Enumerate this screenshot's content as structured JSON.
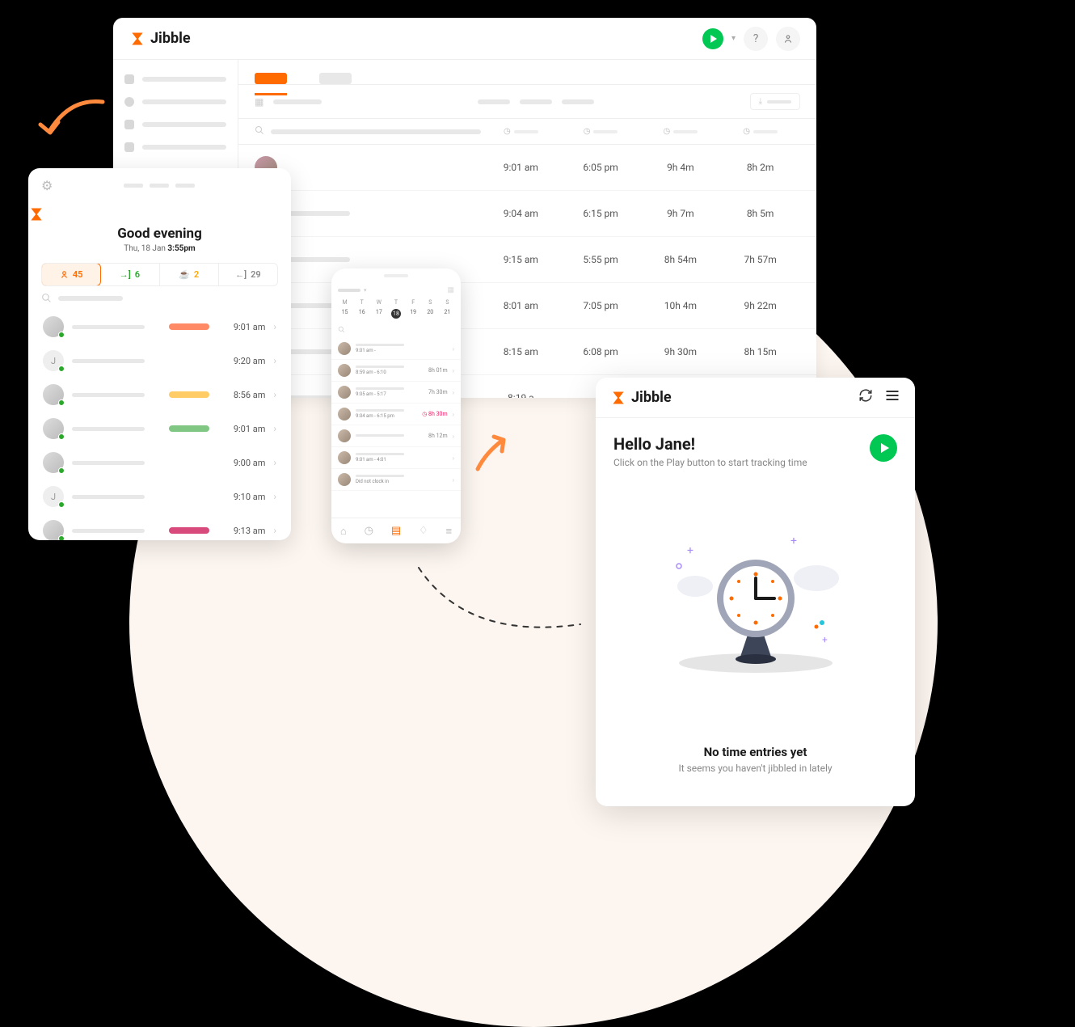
{
  "brand": "Jibble",
  "desktop": {
    "rows": [
      {
        "in": "9:01 am",
        "out": "6:05 pm",
        "tracked": "9h 4m",
        "worked": "8h 2m"
      },
      {
        "in": "9:04 am",
        "out": "6:15 pm",
        "tracked": "9h 7m",
        "worked": "8h 5m"
      },
      {
        "in": "9:15 am",
        "out": "5:55 pm",
        "tracked": "8h 54m",
        "worked": "7h 57m"
      },
      {
        "in": "8:01 am",
        "out": "7:05 pm",
        "tracked": "10h 4m",
        "worked": "9h 22m"
      },
      {
        "in": "8:15 am",
        "out": "6:08 pm",
        "tracked": "9h 30m",
        "worked": "8h 15m"
      },
      {
        "in": "8:19 a",
        "out": "",
        "tracked": "",
        "worked": ""
      }
    ]
  },
  "tablet": {
    "greeting": "Good evening",
    "date_prefix": "Thu, 18 Jan ",
    "date_time": "3:55pm",
    "tabs": {
      "in": "45",
      "enter": "6",
      "break": "2",
      "out": "29"
    },
    "employees": [
      {
        "time": "9:01 am",
        "pill": "#ff8a65",
        "initial": null
      },
      {
        "time": "9:20 am",
        "pill": null,
        "initial": "J"
      },
      {
        "time": "8:56 am",
        "pill": "#ffcc66",
        "initial": null
      },
      {
        "time": "9:01 am",
        "pill": "#81c784",
        "initial": null
      },
      {
        "time": "9:00 am",
        "pill": null,
        "initial": null
      },
      {
        "time": "9:10 am",
        "pill": null,
        "initial": "J"
      },
      {
        "time": "9:13 am",
        "pill": "#d84a7b",
        "initial": null
      }
    ]
  },
  "phone": {
    "days": [
      "M",
      "T",
      "W",
      "T",
      "F",
      "S",
      "S"
    ],
    "dates": [
      "15",
      "16",
      "17",
      "18",
      "19",
      "20",
      "21"
    ],
    "today_index": 3,
    "rows": [
      {
        "sub": "9:01 am -",
        "right": ""
      },
      {
        "sub": "8:59 am - 6:10",
        "right": "8h 01m"
      },
      {
        "sub": "9:05 am - 5:17",
        "right": "7h 30m"
      },
      {
        "sub": "9:04 am - 6:15 pm",
        "right": "8h 30m",
        "red": true
      },
      {
        "sub": "",
        "right": "8h 12m"
      },
      {
        "sub": "9:01 am - 4:01",
        "right": ""
      },
      {
        "sub": "Did not clock in",
        "right": ""
      }
    ]
  },
  "widget": {
    "hello": "Hello Jane!",
    "subtitle": "Click on the Play button to start tracking time",
    "empty_title": "No time entries yet",
    "empty_sub": "It seems you haven't jibbled in lately"
  }
}
